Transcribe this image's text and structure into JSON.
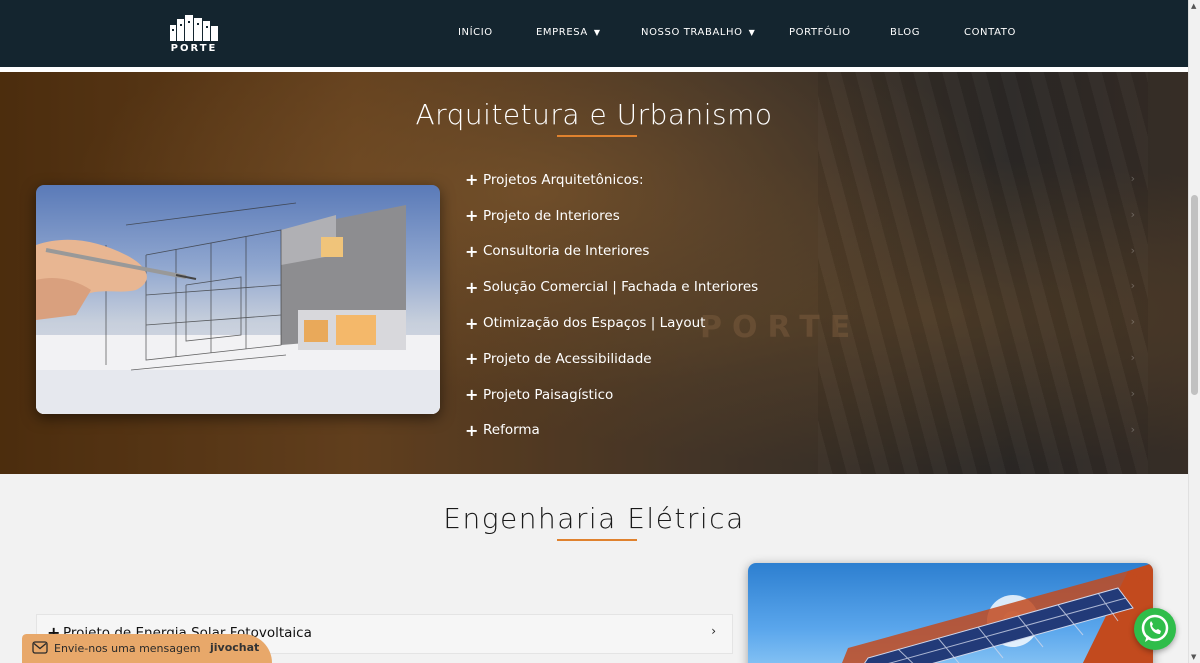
{
  "header": {
    "logo_text": "PORTE",
    "nav": [
      {
        "label": "INÍCIO",
        "has_dropdown": false
      },
      {
        "label": "EMPRESA",
        "has_dropdown": true
      },
      {
        "label": "NOSSO TRABALHO",
        "has_dropdown": true
      },
      {
        "label": "PORTFÓLIO",
        "has_dropdown": false
      },
      {
        "label": "BLOG",
        "has_dropdown": false
      },
      {
        "label": "CONTATO",
        "has_dropdown": false
      }
    ]
  },
  "arquitetura": {
    "title": "Arquitetura e Urbanismo",
    "watermark": "PORTE",
    "items": [
      {
        "label": "Projetos Arquitetônicos:"
      },
      {
        "label": "Projeto de Interiores"
      },
      {
        "label": "Consultoria de Interiores"
      },
      {
        "label": "Solução Comercial | Fachada e Interiores"
      },
      {
        "label": "Otimização dos Espaços | Layout"
      },
      {
        "label": "Projeto de Acessibilidade"
      },
      {
        "label": "Projeto Paisagístico"
      },
      {
        "label": "Reforma"
      }
    ]
  },
  "eletrica": {
    "title": "Engenharia Elétrica",
    "items": [
      {
        "label": "Projeto de Energia Solar Fotovoltaica"
      }
    ]
  },
  "chat": {
    "label": "Envie-nos uma mensagem",
    "brand": "jivochat"
  },
  "icons": {
    "plus": "plus-icon",
    "chevron": "chevron-right-icon",
    "caret": "caret-down-icon",
    "mail": "mail-icon",
    "whatsapp": "whatsapp-icon"
  },
  "colors": {
    "header_bg": "#14252f",
    "accent": "#e0822e",
    "whatsapp": "#2fbd4a"
  }
}
